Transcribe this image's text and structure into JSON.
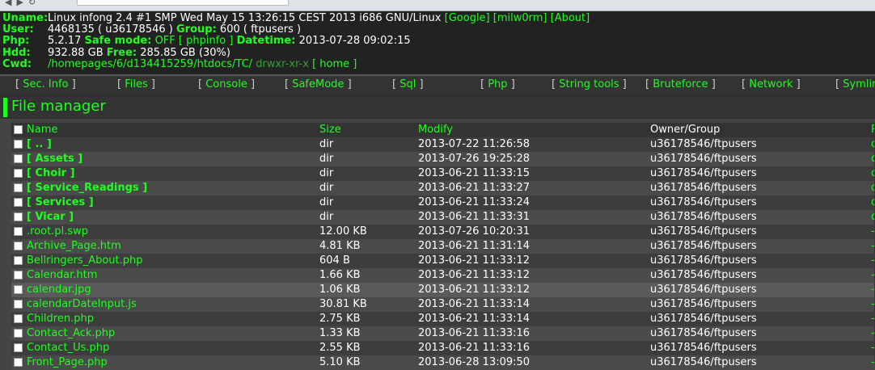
{
  "info": {
    "uname_label": "Uname:",
    "uname": "Linux infong 2.4 #1 SMP Wed May 15 13:26:15 CEST 2013 i686 GNU/Linux",
    "links": [
      "[Google]",
      "[milw0rm]",
      "[About]"
    ],
    "user_label": "User:",
    "user": "4468135 ( u36178546 )",
    "group_label": "Group:",
    "group": "600 ( ftpusers )",
    "php_label": "Php:",
    "php_version": "5.2.17",
    "safe_mode_label": "Safe mode:",
    "safe_mode_value": "OFF",
    "phpinfo_link": "[ phpinfo ]",
    "datetime_label": "Datetime:",
    "datetime": "2013-07-28 09:02:15",
    "hdd_label": "Hdd:",
    "hdd_total": "932.88 GB",
    "free_label": "Free:",
    "hdd_free": "285.85 GB (30%)",
    "cwd_label": "Cwd:",
    "cwd": "/homepages/6/d134415259/htdocs/TC/",
    "cwd_perms": "drwxr-xr-x",
    "home_link": "[ home ]"
  },
  "menu": [
    {
      "label": "Sec. Info"
    },
    {
      "label": "Files"
    },
    {
      "label": "Console"
    },
    {
      "label": "SafeMode"
    },
    {
      "label": "Sql"
    },
    {
      "label": "Php"
    },
    {
      "label": "String tools"
    },
    {
      "label": "Bruteforce"
    },
    {
      "label": "Network"
    },
    {
      "label": "Symlin"
    }
  ],
  "file_manager": {
    "title": "File manager",
    "columns": {
      "name": "Name",
      "size": "Size",
      "modify": "Modify",
      "owner": "Owner/Group",
      "perms": "P"
    },
    "rows": [
      {
        "name": "[ .. ]",
        "size": "dir",
        "modify": "2013-07-22 11:26:58",
        "owner": "u36178546/ftpusers",
        "perm": "d",
        "dir": true
      },
      {
        "name": "[ Assets ]",
        "size": "dir",
        "modify": "2013-07-26 19:25:28",
        "owner": "u36178546/ftpusers",
        "perm": "d",
        "dir": true
      },
      {
        "name": "[ Choir ]",
        "size": "dir",
        "modify": "2013-06-21 11:33:15",
        "owner": "u36178546/ftpusers",
        "perm": "d",
        "dir": true
      },
      {
        "name": "[ Service_Readings ]",
        "size": "dir",
        "modify": "2013-06-21 11:33:27",
        "owner": "u36178546/ftpusers",
        "perm": "d",
        "dir": true
      },
      {
        "name": "[ Services ]",
        "size": "dir",
        "modify": "2013-06-21 11:33:24",
        "owner": "u36178546/ftpusers",
        "perm": "d",
        "dir": true
      },
      {
        "name": "[ Vicar ]",
        "size": "dir",
        "modify": "2013-06-21 11:33:31",
        "owner": "u36178546/ftpusers",
        "perm": "d",
        "dir": true
      },
      {
        "name": ".root.pl.swp",
        "size": "12.00 KB",
        "modify": "2013-07-26 10:20:31",
        "owner": "u36178546/ftpusers",
        "perm": "-",
        "dir": false
      },
      {
        "name": "Archive_Page.htm",
        "size": "4.81 KB",
        "modify": "2013-06-21 11:31:14",
        "owner": "u36178546/ftpusers",
        "perm": "-",
        "dir": false
      },
      {
        "name": "Bellringers_About.php",
        "size": "604 B",
        "modify": "2013-06-21 11:33:12",
        "owner": "u36178546/ftpusers",
        "perm": "-",
        "dir": false
      },
      {
        "name": "Calendar.htm",
        "size": "1.66 KB",
        "modify": "2013-06-21 11:33:12",
        "owner": "u36178546/ftpusers",
        "perm": "-",
        "dir": false
      },
      {
        "name": "calendar.jpg",
        "size": "1.06 KB",
        "modify": "2013-06-21 11:33:12",
        "owner": "u36178546/ftpusers",
        "perm": "-",
        "dir": false,
        "highlight": true
      },
      {
        "name": "calendarDateInput.js",
        "size": "30.81 KB",
        "modify": "2013-06-21 11:33:14",
        "owner": "u36178546/ftpusers",
        "perm": "-",
        "dir": false
      },
      {
        "name": "Children.php",
        "size": "2.75 KB",
        "modify": "2013-06-21 11:33:14",
        "owner": "u36178546/ftpusers",
        "perm": "-",
        "dir": false
      },
      {
        "name": "Contact_Ack.php",
        "size": "1.33 KB",
        "modify": "2013-06-21 11:33:16",
        "owner": "u36178546/ftpusers",
        "perm": "-",
        "dir": false
      },
      {
        "name": "Contact_Us.php",
        "size": "2.55 KB",
        "modify": "2013-06-21 11:33:16",
        "owner": "u36178546/ftpusers",
        "perm": "-",
        "dir": false
      },
      {
        "name": "Front_Page.php",
        "size": "5.10 KB",
        "modify": "2013-06-28 13:09:50",
        "owner": "u36178546/ftpusers",
        "perm": "-",
        "dir": false
      }
    ]
  }
}
